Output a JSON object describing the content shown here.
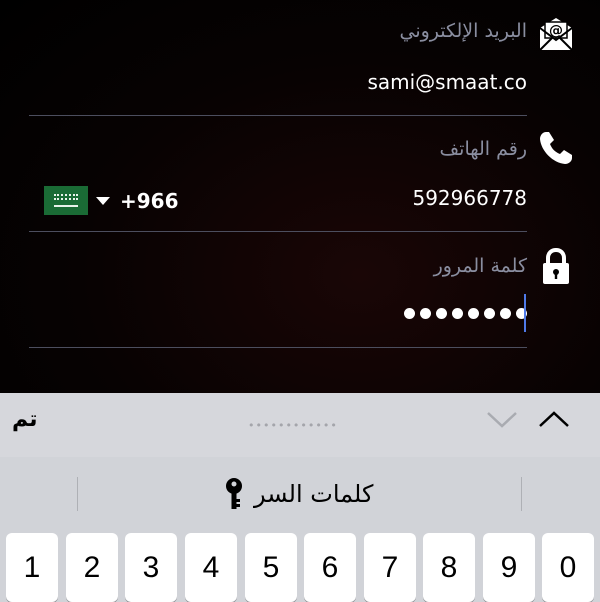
{
  "email": {
    "label": "البريد الإلكتروني",
    "value": "sami@smaat.co",
    "icon": "envelope-at-icon"
  },
  "phone": {
    "label": "رقم الهاتف",
    "value": "592966778",
    "dial_code": "+966",
    "country_flag": "saudi-arabia-flag",
    "icon": "phone-icon"
  },
  "password": {
    "label": "كلمة المرور",
    "masked_length": 8,
    "icon": "lock-icon"
  },
  "accessory_bar": {
    "done_label": "تم",
    "field_placeholder": "••••••••••••"
  },
  "keyboard": {
    "suggestion": "كلمات السر",
    "number_keys": [
      "1",
      "2",
      "3",
      "4",
      "5",
      "6",
      "7",
      "8",
      "9",
      "0"
    ]
  },
  "colors": {
    "background": "#000000",
    "label": "#8a8ea0",
    "cursor": "#4f7ae8",
    "keyboard_bg": "#d1d3d8",
    "accessory_bg": "#d6d7dc"
  }
}
